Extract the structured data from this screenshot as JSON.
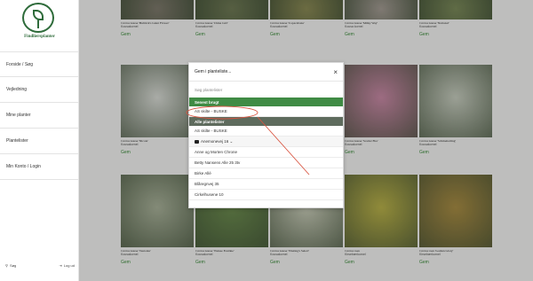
{
  "sidebar": {
    "brand": "Findliersplanter",
    "nav": [
      "Forside / Søg",
      "Vejledning",
      "Mine planter",
      "Plantelister",
      "Min Konto / Login"
    ],
    "search_label": "Søg",
    "logout_label": "Log ud"
  },
  "cards": {
    "r1": [
      {
        "name": "Cornus kousa",
        "cultivar": "'Bultrick's Giant Flower'",
        "desc": "Kousakornel",
        "gem": "Gem",
        "color": "#7e7a6c"
      },
      {
        "name": "Cornus kousa",
        "cultivar": "'China Girl'",
        "desc": "Kousakornel",
        "gem": "Gem",
        "color": "#6f7a55"
      },
      {
        "name": "Cornus kousa",
        "cultivar": "'Copacabana'",
        "desc": "Kousakornel",
        "gem": "Gem",
        "color": "#8a8a55"
      },
      {
        "name": "Cornus kousa",
        "cultivar": "'Milky Way'",
        "desc": "Kousa kornel",
        "gem": "Gem",
        "color": "#a39c93"
      },
      {
        "name": "Cornus kousa",
        "cultivar": "'National'",
        "desc": "Kousakornel",
        "gem": "Gem",
        "color": "#7b8a5a"
      }
    ],
    "r2": [
      {
        "name": "Cornus kousa",
        "cultivar": "'Nicole'",
        "desc": "Kousakornel",
        "gem": "Gem",
        "color": "#d9dcd6"
      },
      {
        "name": "Cornus kousa",
        "cultivar": "'Scarlet Fire'",
        "desc": "Kousakornel",
        "gem": "Gem",
        "color": "#c98aa6"
      },
      {
        "name": "Cornus kousa",
        "cultivar": "'Schmetterling'",
        "desc": "Kousakornel",
        "gem": "Gem",
        "color": "#c7cdbf"
      }
    ],
    "r3": [
      {
        "name": "Cornus kousa",
        "cultivar": "'Teutonia'",
        "desc": "Kousakornel",
        "gem": "Gem",
        "color": "#a9b29a"
      },
      {
        "name": "Cornus kousa",
        "cultivar": "'Weisse Fontäne'",
        "desc": "Kousakornel",
        "gem": "Gem",
        "color": "#6c8c4f"
      },
      {
        "name": "Cornus kousa",
        "cultivar": "'Wieting's Select'",
        "desc": "Kousakornel",
        "gem": "Gem",
        "color": "#c8ccb8"
      },
      {
        "name": "Cornus mas",
        "cultivar": "",
        "desc": "Kirsebærkornel",
        "gem": "Gem",
        "color": "#b9b24a"
      },
      {
        "name": "Cornus mas",
        "cultivar": "'Golden Glory'",
        "desc": "Kirsebærkornel",
        "gem": "Gem",
        "color": "#a88d44"
      }
    ]
  },
  "modal": {
    "title": "Gem i planteliste...",
    "close": "×",
    "search_placeholder": "Søg plantelister",
    "recent_header": "Senest brugt",
    "recent": [
      "AS skilte - BUSKE"
    ],
    "all_header": "Alle plantelister",
    "rows": [
      "AS skilte - BUSKE",
      "Anemonevej 16 ⌄",
      "Anne og Morten Chrone",
      "Betty Nansens Alle 25 3tv",
      "Birke Allé",
      "Blåregnvej 35",
      "Cirkelhusene 10"
    ]
  },
  "colors": {
    "accent": "#3f8b44",
    "annotation": "#d9533f"
  }
}
